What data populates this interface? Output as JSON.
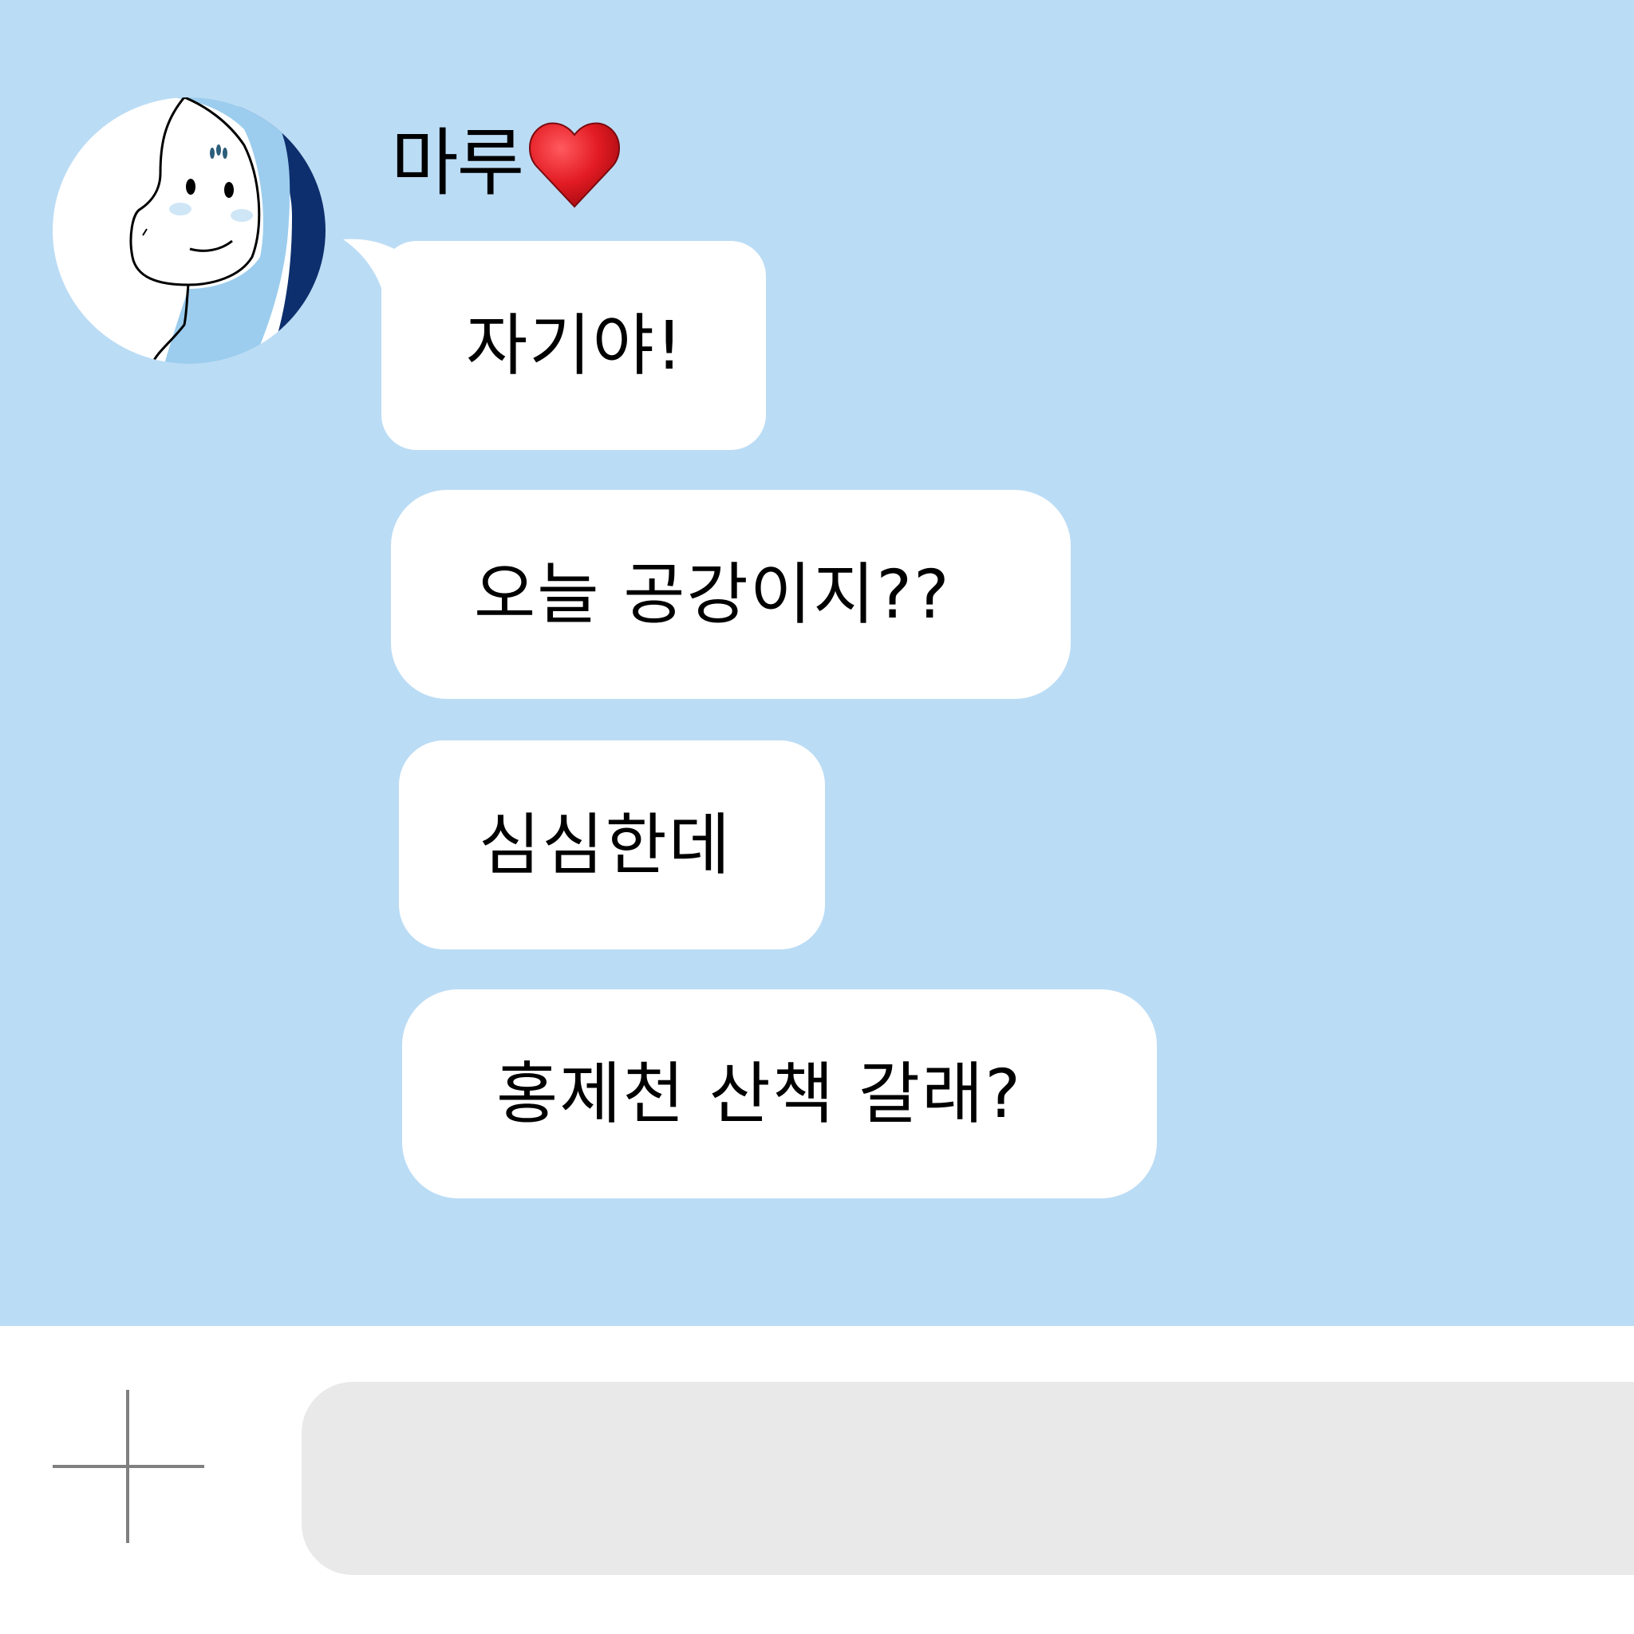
{
  "chat": {
    "sender": {
      "name": "마루",
      "heart_emoji": "heart-icon"
    },
    "messages": [
      {
        "text": "자기야!"
      },
      {
        "text": "오늘 공강이지??"
      },
      {
        "text": "심심한데"
      },
      {
        "text": "홍제천 산책 갈래?"
      }
    ]
  },
  "input_bar": {
    "add_icon": "plus-icon",
    "message_value": ""
  },
  "colors": {
    "chat_background": "#bbdcf5",
    "bubble": "#ffffff",
    "input_field": "#e9e9e9",
    "heart": "#e31b23"
  }
}
